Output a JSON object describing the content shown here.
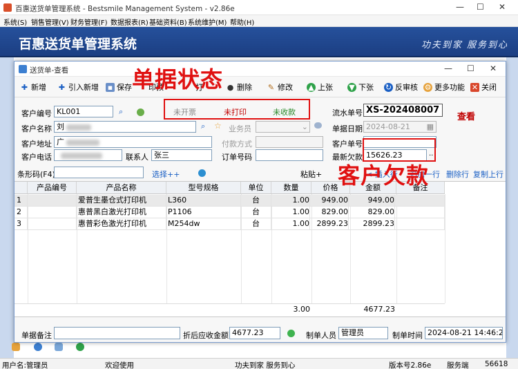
{
  "app": {
    "window_title": "百惠送货单管理系统 - Bestsmile Management System - v2.86e",
    "menu": [
      "系统(S)",
      "销售管理(V)",
      "财务管理(F)",
      "数据报表(R)",
      "基础资料(B)",
      "系统维护(M)",
      "帮助(H)"
    ],
    "banner_title": "百惠送货单管理系统",
    "banner_slogan": "功夫到家 服务到心",
    "window_controls": {
      "minimize": "—",
      "maximize": "☐",
      "close": "✕"
    }
  },
  "dialog": {
    "title": "送货单-查看",
    "controls": {
      "minimize": "—",
      "maximize": "☐",
      "close": "✕"
    },
    "toolbar": {
      "new": "新增",
      "import_new": "引入新增",
      "save": "保存",
      "print_preview": "印预",
      "print": "打",
      "delete": "删除",
      "edit": "修改",
      "prev": "上张",
      "next": "下张",
      "unapprove": "反审核",
      "more": "更多功能",
      "close": "关闭"
    },
    "status": {
      "invoice": "未开票",
      "print": "未打印",
      "payment": "未收款"
    },
    "form": {
      "customer_code_label": "客户编号",
      "customer_code": "KL001",
      "customer_name_label": "客户名称",
      "customer_name_prefix": "刘",
      "customer_address_label": "客户地址",
      "customer_address_prefix": "广",
      "customer_phone_label": "客户电话",
      "contact_label": "联系人",
      "contact": "张三",
      "salesperson_label": "业务员",
      "payment_method_label": "付款方式",
      "order_no_label": "订单号码",
      "serial_no_label": "流水单号",
      "serial_no": "XS-202408007",
      "doc_date_label": "单据日期",
      "doc_date": "2024-08-21",
      "customer_doc_label": "客户单号",
      "latest_debt_label": "最新欠款",
      "latest_debt": "15626.23",
      "view_mode": "查看",
      "barcode_label": "条形码(F4)",
      "select_link": "选择++",
      "paste_label": "粘贴+",
      "insert_row": "插入行",
      "append_row": "追加一行",
      "delete_row": "删除行",
      "copy_up": "复制上行"
    },
    "grid": {
      "columns": [
        "",
        "产品编号",
        "产品名称",
        "型号规格",
        "单位",
        "数量",
        "价格",
        "金额",
        "备注"
      ],
      "rows": [
        [
          "1",
          "",
          "爱普生墨仓式打印机",
          "L360",
          "台",
          "1.00",
          "949.00",
          "949.00",
          ""
        ],
        [
          "2",
          "",
          "惠普黑白激光打印机",
          "P1106",
          "台",
          "1.00",
          "829.00",
          "829.00",
          ""
        ],
        [
          "3",
          "",
          "惠普彩色激光打印机",
          "M254dw",
          "台",
          "1.00",
          "2899.23",
          "2899.23",
          ""
        ]
      ],
      "total_qty": "3.00",
      "total_amount": "4677.23"
    },
    "footer": {
      "remark_label": "单据备注",
      "after_discount_label": "折后应收金额",
      "after_discount": "4677.23",
      "creator_label": "制单人员",
      "creator": "管理员",
      "created_time_label": "制单时间",
      "created_time": "2024-08-21 14:46:23"
    }
  },
  "annotations": {
    "doc_status": "单据状态",
    "customer_debt": "客户欠款"
  },
  "statusbar": {
    "user": "用户名:管理员",
    "welcome": "欢迎使用",
    "slogan": "功夫到家 服务到心",
    "version": "版本号2.86e",
    "server": "服务端",
    "port": "56618"
  },
  "colors": {
    "banner": "#1f4590",
    "annotation": "#e01010",
    "status_green": "#2a8a2a",
    "status_red": "#c00000"
  }
}
